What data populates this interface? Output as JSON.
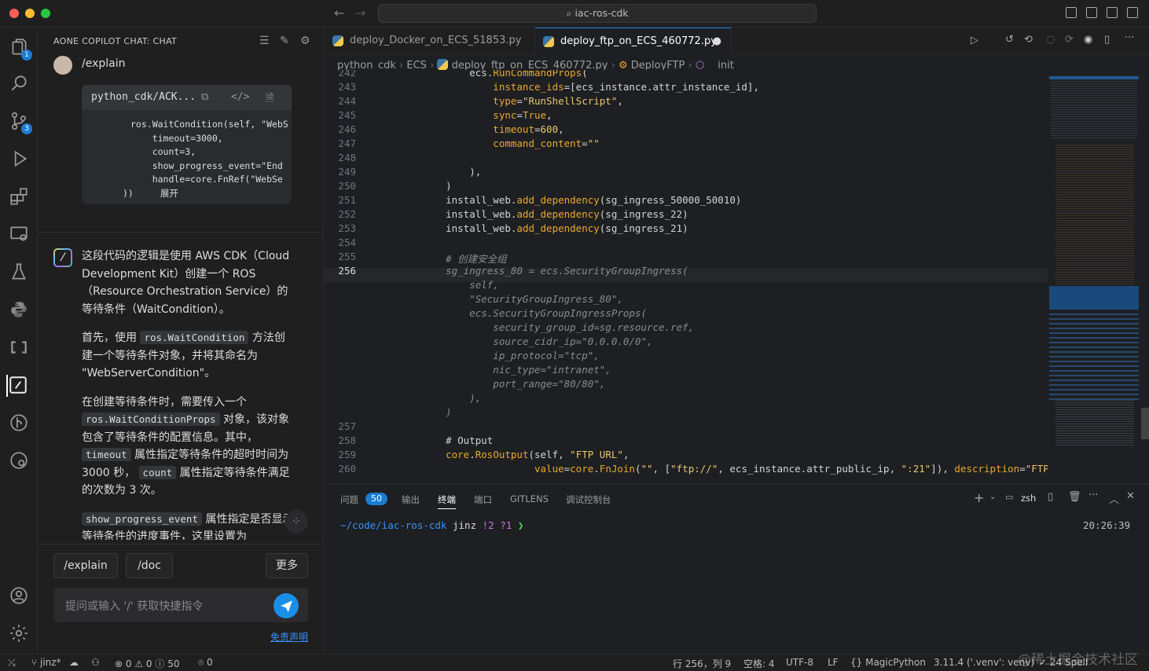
{
  "titlebar": {
    "search": "iac-ros-cdk"
  },
  "activity": {
    "explorer_badge": "1",
    "scm_badge": "3"
  },
  "sidebar": {
    "title": "AONE COPILOT CHAT: CHAT",
    "user_command": "/explain",
    "code_card": {
      "filename": "python_cdk/ACK...",
      "lines": [
        "ros.WaitCondition(self, \"WebS",
        "    timeout=3000,",
        "    count=3,",
        "    show_progress_event=\"End",
        "    handle=core.FnRef(\"WebSe"
      ],
      "trail": "))",
      "expand_label": "展开"
    },
    "ai_response": {
      "p1": "这段代码的逻辑是使用 AWS CDK（Cloud Development Kit）创建一个 ROS（Resource Orchestration Service）的等待条件（WaitCondition）。",
      "p2_a": "首先，使用",
      "p2_code": "ros.WaitCondition",
      "p2_b": "方法创建一个等待条件对象，并将其命名为 \"WebServerCondition\"。",
      "p3_a": "在创建等待条件时，需要传入一个",
      "p3_code1": "ros.WaitConditionProps",
      "p3_b": "对象，该对象包含了等待条件的配置信息。其中，",
      "p3_code2": "timeout",
      "p3_c": "属性指定等待条件的超时时间为 3000 秒，",
      "p3_code3": "count",
      "p3_d": "属性指定等待条件满足的次数为 3 次。",
      "p4_code": "show_progress_event",
      "p4_a": "属性指定是否显示等待条件的进度事件，这里设置为"
    },
    "quick": [
      "/explain",
      "/doc",
      "更多"
    ],
    "prompt_placeholder": "提问或输入 '/' 获取快捷指令",
    "disclaimer": "免责声明"
  },
  "tabs": [
    {
      "label": "deploy_Docker_on_ECS_51853.py",
      "active": false
    },
    {
      "label": "deploy_ftp_on_ECS_460772.py",
      "active": true
    }
  ],
  "breadcrumbs": [
    "python_cdk",
    "ECS",
    "deploy_ftp_on_ECS_460772.py",
    "DeployFTP",
    "__init__"
  ],
  "editor": {
    "lines": [
      {
        "n": "242",
        "html": "<span class='n'>        ecs.</span><span class='k'>RunCommandProps</span><span class='n'>(</span>"
      },
      {
        "n": "243",
        "html": "<span class='k'>            instance_ids</span><span class='n'>=[ecs_instance.attr_instance_id],</span>"
      },
      {
        "n": "244",
        "html": "<span class='k'>            type</span><span class='n'>=</span><span class='s'>\"RunShellScript\"</span><span class='n'>,</span>"
      },
      {
        "n": "245",
        "html": "<span class='k'>            sync</span><span class='n'>=</span><span class='k'>True</span><span class='n'>,</span>"
      },
      {
        "n": "246",
        "html": "<span class='k'>            timeout</span><span class='n'>=</span><span class='s'>600</span><span class='n'>,</span>"
      },
      {
        "n": "247",
        "html": "<span class='k'>            command_content</span><span class='n'>=</span><span class='s'>\"\"</span>"
      },
      {
        "n": "248",
        "html": ""
      },
      {
        "n": "249",
        "html": "<span class='n'>        ),</span>"
      },
      {
        "n": "250",
        "html": "<span class='n'>    )</span>"
      },
      {
        "n": "251",
        "html": "<span class='n'>    install_web.</span><span class='k'>add_dependency</span><span class='n'>(sg_ingress_50000_50010)</span>"
      },
      {
        "n": "252",
        "html": "<span class='n'>    install_web.</span><span class='k'>add_dependency</span><span class='n'>(sg_ingress_22)</span>"
      },
      {
        "n": "253",
        "html": "<span class='n'>    install_web.</span><span class='k'>add_dependency</span><span class='n'>(sg_ingress_21)</span>"
      },
      {
        "n": "254",
        "html": ""
      },
      {
        "n": "255",
        "html": "<span class='g'>    # 创建安全组</span>"
      },
      {
        "n": "256",
        "html": "<span class='g'>    sg_ingress_80 = ecs.SecurityGroupIngress(</span>"
      },
      {
        "n": "",
        "html": "<span class='g'>        self,</span>"
      },
      {
        "n": "",
        "html": "<span class='g'>        \"SecurityGroupIngress_80\",</span>"
      },
      {
        "n": "",
        "html": "<span class='g'>        ecs.SecurityGroupIngressProps(</span>"
      },
      {
        "n": "",
        "html": "<span class='g'>            security_group_id=sg.resource.ref,</span>"
      },
      {
        "n": "",
        "html": "<span class='g'>            source_cidr_ip=\"0.0.0.0/0\",</span>"
      },
      {
        "n": "",
        "html": "<span class='g'>            ip_protocol=\"tcp\",</span>"
      },
      {
        "n": "",
        "html": "<span class='g'>            nic_type=\"intranet\",</span>"
      },
      {
        "n": "",
        "html": "<span class='g'>            port_range=\"80/80\",</span>"
      },
      {
        "n": "",
        "html": "<span class='g'>        ),</span>"
      },
      {
        "n": "",
        "html": "<span class='g'>    )</span>"
      },
      {
        "n": "257",
        "html": ""
      },
      {
        "n": "258",
        "html": "<span class='n'>    # Output</span>"
      },
      {
        "n": "259",
        "html": "<span class='k'>    core</span><span class='n'>.</span><span class='k'>RosOutput</span><span class='n'>(self, </span><span class='s'>\"FTP URL\"</span><span class='n'>,</span>"
      },
      {
        "n": "260",
        "html": "<span class='k'>                   value</span><span class='n'>=</span><span class='k'>core</span><span class='n'>.</span><span class='k'>FnJoin</span><span class='n'>(</span><span class='s'>\"\"</span><span class='n'>, [</span><span class='s'>\"ftp://\"</span><span class='n'>, ecs_instance.attr_public_ip, </span><span class='s'>\":21\"</span><span class='n'>]), </span><span class='k'>description</span><span class='n'>=</span><span class='s'>\"FTP</span>"
      }
    ]
  },
  "panel": {
    "tabs": [
      "问题",
      "输出",
      "终端",
      "端口",
      "GITLENS",
      "调试控制台"
    ],
    "problems_count": "50",
    "shell": "zsh",
    "prompt_path": "~/code/iac-ros-cdk",
    "prompt_branch": "jinz",
    "prompt_status": "!2 ?1",
    "prompt_arrow": "❯",
    "time": "20:26:39"
  },
  "status": {
    "branch": "jinz*",
    "errors": "0",
    "warnings": "0",
    "infos": "50",
    "ports": "0",
    "position": "行 256，列 9",
    "spaces": "空格: 4",
    "encoding": "UTF-8",
    "eol": "LF",
    "language": "MagicPython",
    "interpreter": "3.11.4 ('.venv': venv)",
    "spell": "24 Spell"
  },
  "watermark": "@稀土掘金技术社区"
}
